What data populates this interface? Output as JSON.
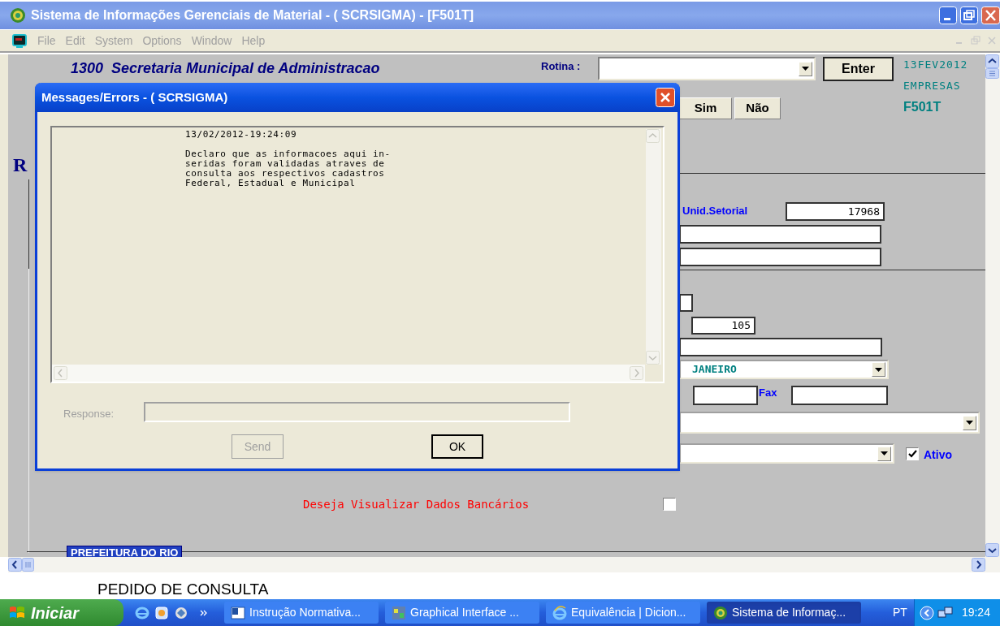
{
  "window": {
    "title": "Sistema de Informações Gerenciais de Material - ( SCRSIGMA) - [F501T]"
  },
  "menu": [
    "File",
    "Edit",
    "System",
    "Options",
    "Window",
    "Help"
  ],
  "header": {
    "org": "1300  Secretaria Municipal de Administracao",
    "rotina_label": "Rotina :",
    "enter": "Enter",
    "date": "13FEV2012",
    "module": "EMPRESAS",
    "form": "F501T",
    "sim": "Sim",
    "nao": "Não",
    "heading": "R"
  },
  "form": {
    "unid_label": "Unid.Setorial",
    "unid_value": "17968",
    "number_value": "105",
    "city_value": "JANEIRO",
    "fax_label": "Fax",
    "ativo_label": "Ativo",
    "ativo_checked": true,
    "bank_label": "Deseja Visualizar Dados Bancários",
    "bank_checked": false,
    "banner": "PREFEITURA DO RIO"
  },
  "dialog": {
    "title": "Messages/Errors - ( SCRSIGMA)",
    "timestamp": "13/02/2012-19:24:09",
    "message_lines": [
      "Declaro que as informacoes aqui in-",
      "seridas foram validadas atraves de",
      "consulta aos respectivos cadastros",
      "Federal, Estadual e Municipal"
    ],
    "response_label": "Response:",
    "response_disabled": true,
    "send": "Send",
    "send_disabled": true,
    "ok": "OK"
  },
  "footer": "PEDIDO DE CONSULTA",
  "taskbar": {
    "start": "Iniciar",
    "tasks": [
      {
        "label": "Instrução Normativa...",
        "selected": false
      },
      {
        "label": "Graphical Interface ...",
        "selected": false
      },
      {
        "label": "Equivalência | Dicion...",
        "selected": false
      },
      {
        "label": "Sistema de Informaç...",
        "selected": true
      }
    ],
    "language": "PT",
    "clock": "19:24"
  }
}
